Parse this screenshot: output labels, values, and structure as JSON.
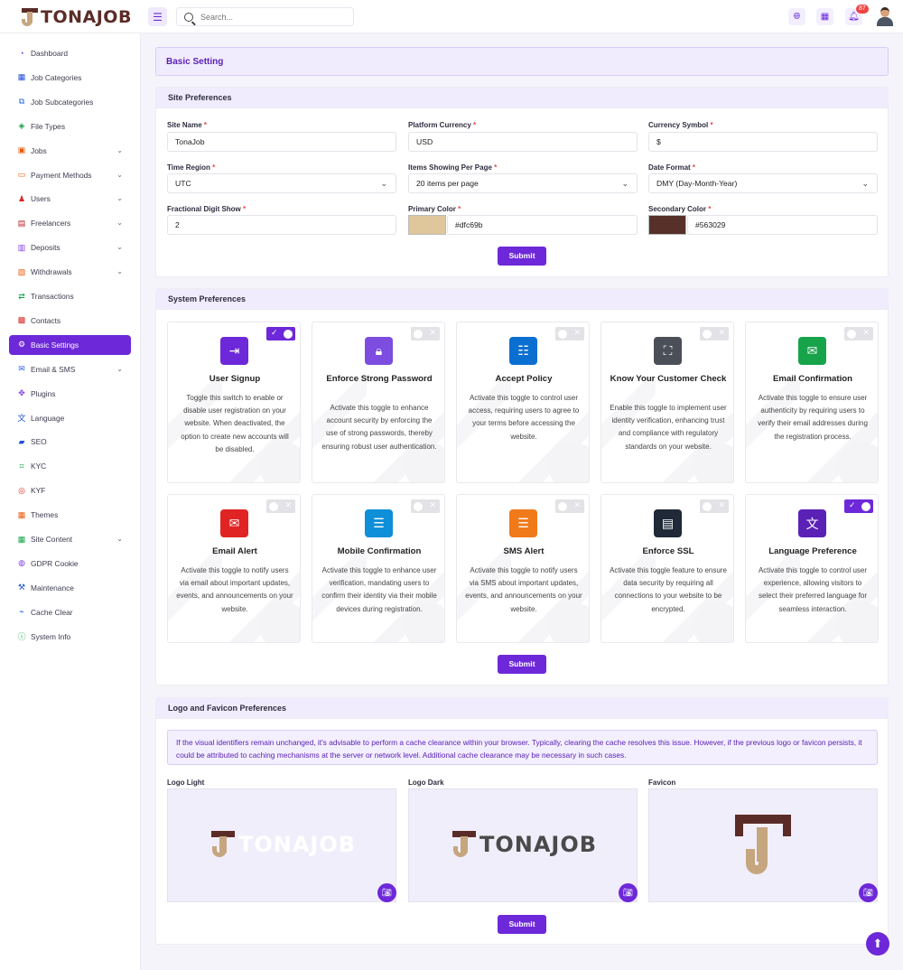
{
  "app": {
    "brand": "TONAJOB",
    "search_placeholder": "Search...",
    "notification_count": "87",
    "accent_color": "#6d28d9"
  },
  "sidebar": {
    "items": [
      {
        "label": "Dashboard",
        "icon": "dashboard-icon",
        "glyph": "◔",
        "color": "#7c3aed",
        "chevron": false,
        "active": false
      },
      {
        "label": "Job Categories",
        "icon": "grid-icon",
        "glyph": "▦",
        "color": "#1d4ed8",
        "chevron": false,
        "active": false
      },
      {
        "label": "Job Subcategories",
        "icon": "sitemap-icon",
        "glyph": "⧉",
        "color": "#2563eb",
        "chevron": false,
        "active": false
      },
      {
        "label": "File Types",
        "icon": "tag-icon",
        "glyph": "◈",
        "color": "#16a34a",
        "chevron": false,
        "active": false
      },
      {
        "label": "Jobs",
        "icon": "briefcase-icon",
        "glyph": "▣",
        "color": "#ea580c",
        "chevron": true,
        "active": false
      },
      {
        "label": "Payment Methods",
        "icon": "card-icon",
        "glyph": "▭",
        "color": "#ea580c",
        "chevron": true,
        "active": false
      },
      {
        "label": "Users",
        "icon": "users-icon",
        "glyph": "♟",
        "color": "#dc2626",
        "chevron": true,
        "active": false
      },
      {
        "label": "Freelancers",
        "icon": "freelancer-icon",
        "glyph": "▤",
        "color": "#b91c1c",
        "chevron": true,
        "active": false
      },
      {
        "label": "Deposits",
        "icon": "deposit-icon",
        "glyph": "▥",
        "color": "#7c3aed",
        "chevron": true,
        "active": false
      },
      {
        "label": "Withdrawals",
        "icon": "withdraw-icon",
        "glyph": "▨",
        "color": "#ea580c",
        "chevron": true,
        "active": false
      },
      {
        "label": "Transactions",
        "icon": "exchange-icon",
        "glyph": "⇄",
        "color": "#16a34a",
        "chevron": false,
        "active": false
      },
      {
        "label": "Contacts",
        "icon": "contacts-icon",
        "glyph": "▩",
        "color": "#dc2626",
        "chevron": false,
        "active": false
      },
      {
        "label": "Basic Settings",
        "icon": "gear-icon",
        "glyph": "⚙",
        "color": "#ffffff",
        "chevron": false,
        "active": true
      },
      {
        "label": "Email & SMS",
        "icon": "mail-icon",
        "glyph": "✉",
        "color": "#2563eb",
        "chevron": true,
        "active": false
      },
      {
        "label": "Plugins",
        "icon": "plugin-icon",
        "glyph": "✥",
        "color": "#7c3aed",
        "chevron": false,
        "active": false
      },
      {
        "label": "Language",
        "icon": "language-icon",
        "glyph": "文",
        "color": "#1d4ed8",
        "chevron": false,
        "active": false
      },
      {
        "label": "SEO",
        "icon": "seo-icon",
        "glyph": "▰",
        "color": "#1d4ed8",
        "chevron": false,
        "active": false
      },
      {
        "label": "KYC",
        "icon": "kyc-icon",
        "glyph": "⌗",
        "color": "#16a34a",
        "chevron": false,
        "active": false
      },
      {
        "label": "KYF",
        "icon": "kyf-icon",
        "glyph": "◎",
        "color": "#dc2626",
        "chevron": false,
        "active": false
      },
      {
        "label": "Themes",
        "icon": "themes-icon",
        "glyph": "▦",
        "color": "#ea580c",
        "chevron": false,
        "active": false
      },
      {
        "label": "Site Content",
        "icon": "content-icon",
        "glyph": "▦",
        "color": "#16a34a",
        "chevron": true,
        "active": false
      },
      {
        "label": "GDPR Cookie",
        "icon": "cookie-icon",
        "glyph": "◍",
        "color": "#7c3aed",
        "chevron": false,
        "active": false
      },
      {
        "label": "Maintenance",
        "icon": "maintenance-icon",
        "glyph": "⚒",
        "color": "#1d4ed8",
        "chevron": false,
        "active": false
      },
      {
        "label": "Cache Clear",
        "icon": "broom-icon",
        "glyph": "⌁",
        "color": "#2563eb",
        "chevron": false,
        "active": false
      },
      {
        "label": "System Info",
        "icon": "info-icon",
        "glyph": "ⓘ",
        "color": "#16a34a",
        "chevron": false,
        "active": false
      }
    ]
  },
  "page": {
    "title": "Basic Setting"
  },
  "site_preferences": {
    "heading": "Site Preferences",
    "fields": {
      "site_name": {
        "label": "Site Name",
        "value": "TonaJob"
      },
      "platform_currency": {
        "label": "Platform Currency",
        "value": "USD"
      },
      "currency_symbol": {
        "label": "Currency Symbol",
        "value": "$"
      },
      "time_region": {
        "label": "Time Region",
        "value": "UTC"
      },
      "items_per_page": {
        "label": "Items Showing Per Page",
        "value": "20 items per page"
      },
      "date_format": {
        "label": "Date Format",
        "value": "DMY (Day-Month-Year)"
      },
      "fractional_digit": {
        "label": "Fractional Digit Show",
        "value": "2"
      },
      "primary_color": {
        "label": "Primary Color",
        "value": "#dfc69b"
      },
      "secondary_color": {
        "label": "Secondary Color",
        "value": "#563029"
      }
    },
    "required_mark": "*",
    "submit_label": "Submit"
  },
  "system_preferences": {
    "heading": "System Preferences",
    "submit_label": "Submit",
    "cards": [
      {
        "title": "User Signup",
        "desc": "Toggle this switch to enable or disable user registration on your website. When deactivated, the option to create new accounts will be disabled.",
        "enabled": true,
        "icon": "signup-icon",
        "glyph": "⇥",
        "color": "#6d28d9"
      },
      {
        "title": "Enforce Strong Password",
        "desc": "Activate this toggle to enhance account security by enforcing the use of strong passwords, thereby ensuring robust user authentication.",
        "enabled": false,
        "icon": "lock-icon",
        "glyph": "🔒︎",
        "color": "#7c4ddf"
      },
      {
        "title": "Accept Policy",
        "desc": "Activate this toggle to control user access, requiring users to agree to your terms before accessing the website.",
        "enabled": false,
        "icon": "clipboard-icon",
        "glyph": "☷",
        "color": "#0b6fd1"
      },
      {
        "title": "Know Your Customer Check",
        "desc": "Enable this toggle to implement user identity verification, enhancing trust and compliance with regulatory standards on your website.",
        "enabled": false,
        "icon": "scan-icon",
        "glyph": "⛶",
        "color": "#4b4f58"
      },
      {
        "title": "Email Confirmation",
        "desc": "Activate this toggle to ensure user authenticity by requiring users to verify their email addresses during the registration process.",
        "enabled": false,
        "icon": "mail-check-icon",
        "glyph": "✉",
        "color": "#17a34a"
      },
      {
        "title": "Email Alert",
        "desc": "Activate this toggle to notify users via email about important updates, events, and announcements on your website.",
        "enabled": false,
        "icon": "mail-alert-icon",
        "glyph": "✉",
        "color": "#e02424"
      },
      {
        "title": "Mobile Confirmation",
        "desc": "Activate this toggle to enhance user verification, mandating users to confirm their identity via their mobile devices during registration.",
        "enabled": false,
        "icon": "message-icon",
        "glyph": "☰",
        "color": "#0e8fd8"
      },
      {
        "title": "SMS Alert",
        "desc": "Activate this toggle to notify users via SMS about important updates, events, and announcements on your website.",
        "enabled": false,
        "icon": "sms-icon",
        "glyph": "☰",
        "color": "#f07a1a"
      },
      {
        "title": "Enforce SSL",
        "desc": "Activate this toggle feature to ensure data security by requiring all connections to your website to be encrypted.",
        "enabled": false,
        "icon": "certificate-icon",
        "glyph": "▤",
        "color": "#1f2937"
      },
      {
        "title": "Language Preference",
        "desc": "Activate this toggle to control user experience, allowing visitors to select their preferred language for seamless interaction.",
        "enabled": true,
        "icon": "translate-icon",
        "glyph": "文",
        "color": "#5b21b6"
      }
    ]
  },
  "logo_preferences": {
    "heading": "Logo and Favicon Preferences",
    "notice": "If the visual identifiers remain unchanged, it's advisable to perform a cache clearance within your browser. Typically, clearing the cache resolves this issue. However, if the previous logo or favicon persists, it could be attributed to caching mechanisms at the server or network level. Additional cache clearance may be necessary in such cases.",
    "logo_light_label": "Logo Light",
    "logo_dark_label": "Logo Dark",
    "favicon_label": "Favicon",
    "submit_label": "Submit"
  }
}
